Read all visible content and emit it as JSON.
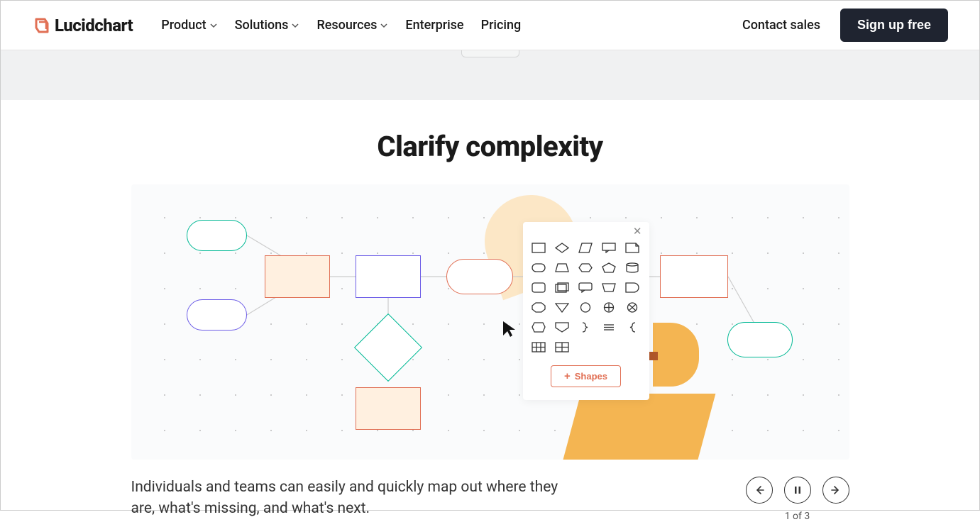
{
  "brand": {
    "name": "Lucidchart"
  },
  "nav": {
    "items": [
      {
        "label": "Product",
        "hasDropdown": true
      },
      {
        "label": "Solutions",
        "hasDropdown": true
      },
      {
        "label": "Resources",
        "hasDropdown": true
      },
      {
        "label": "Enterprise",
        "hasDropdown": false
      },
      {
        "label": "Pricing",
        "hasDropdown": false
      }
    ]
  },
  "header": {
    "contact": "Contact sales",
    "signup": "Sign up free"
  },
  "section": {
    "title": "Clarify complexity",
    "caption": "Individuals and teams can easily and quickly map out where they are, what's missing, and what's next."
  },
  "shapes_panel": {
    "button_label": "Shapes",
    "icon_names": [
      "rectangle",
      "diamond-h",
      "parallelogram",
      "callout",
      "note",
      "pill-round",
      "trapezoid",
      "hexagon",
      "pentagon",
      "cylinder",
      "rounded-rect",
      "rect-stack",
      "speech",
      "trapezoid2",
      "d-shape",
      "octagon",
      "triangle-down",
      "circle",
      "circle-plus",
      "circle-x",
      "hex-cut",
      "shield",
      "brace-right",
      "summation",
      "brace-left",
      "table3",
      "table2"
    ]
  },
  "carousel": {
    "indicator": "1 of 3"
  }
}
